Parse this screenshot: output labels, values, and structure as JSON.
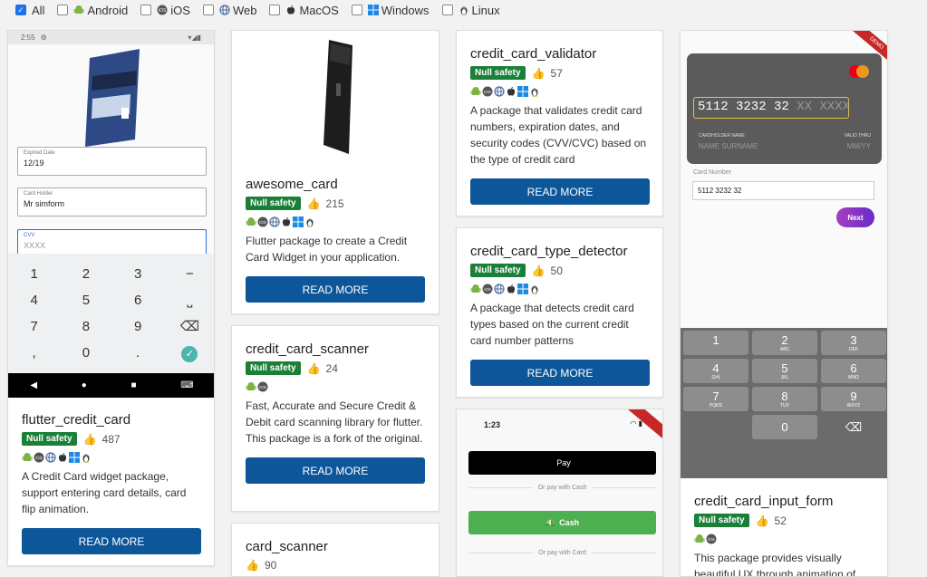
{
  "filters": [
    {
      "label": "All",
      "checked": true,
      "icon": "none"
    },
    {
      "label": "Android",
      "checked": false,
      "icon": "android-icon"
    },
    {
      "label": "iOS",
      "checked": false,
      "icon": "ios-icon"
    },
    {
      "label": "Web",
      "checked": false,
      "icon": "web-icon"
    },
    {
      "label": "MacOS",
      "checked": false,
      "icon": "apple-icon"
    },
    {
      "label": "Windows",
      "checked": false,
      "icon": "windows-icon"
    },
    {
      "label": "Linux",
      "checked": false,
      "icon": "linux-icon"
    }
  ],
  "common": {
    "null_safety": "Null safety",
    "read_more": "READ MORE",
    "thumb": "👍"
  },
  "colors": {
    "button": "#0d569a",
    "null_safety": "#1a7f37",
    "android": "#7cb342",
    "windows": "#1e88e5"
  },
  "cards": {
    "flutter_credit_card": {
      "title": "flutter_credit_card",
      "likes": "487",
      "desc": "A Credit Card widget package, support entering card details, card flip animation.",
      "shot": {
        "status_time": "2:55",
        "expired_label": "Expired Date",
        "expired_value": "12/19",
        "holder_label": "Card Holder",
        "holder_value": "Mr simform",
        "cvv_label": "CVV",
        "cvv_placeholder": "XXXX",
        "keys": [
          "1",
          "2",
          "3",
          "−",
          "4",
          "5",
          "6",
          "⎵",
          "7",
          "8",
          "9",
          "⌫",
          ",",
          "0",
          ".",
          "✓"
        ]
      }
    },
    "awesome_card": {
      "title": "awesome_card",
      "likes": "215",
      "desc": "Flutter package to create a Credit Card Widget in your application."
    },
    "credit_card_scanner": {
      "title": "credit_card_scanner",
      "likes": "24",
      "desc": "Fast, Accurate and Secure Credit & Debit card scanning library for flutter. This package is a fork of the original."
    },
    "card_scanner": {
      "title": "card_scanner",
      "likes": "90"
    },
    "credit_card_validator": {
      "title": "credit_card_validator",
      "likes": "57",
      "desc": "A package that validates credit card numbers, expiration dates, and security codes (CVV/CVC) based on the type of credit card"
    },
    "credit_card_type_detector": {
      "title": "credit_card_type_detector",
      "likes": "50",
      "desc": "A package that detects credit card types based on the current credit card number patterns"
    },
    "pay_shot": {
      "time": "1:23",
      "apple_pay": "Pay",
      "or_cash": "Or pay with Cash",
      "cash": "Cash",
      "or_card": "Or pay with Card"
    },
    "credit_card_input_form": {
      "title": "credit_card_input_form",
      "likes": "52",
      "desc": "This package provides visually beautiful UX through animation of",
      "shot": {
        "ribbon": "DEMO",
        "card_number": "5112 3232 32",
        "card_number_mask": "XX XXXX",
        "holder_label": "CARDHOLDER NAME",
        "holder_value": "NAME SURNAME",
        "valid_label": "VALID THRU",
        "valid_value": "MM/YY",
        "field_label": "Card Number",
        "field_value": "5112 3232 32",
        "next": "Next",
        "keys": [
          {
            "d": "1",
            "l": ""
          },
          {
            "d": "2",
            "l": "ABC"
          },
          {
            "d": "3",
            "l": "DEF"
          },
          {
            "d": "4",
            "l": "GHI"
          },
          {
            "d": "5",
            "l": "JKL"
          },
          {
            "d": "6",
            "l": "MNO"
          },
          {
            "d": "7",
            "l": "PQRS"
          },
          {
            "d": "8",
            "l": "TUV"
          },
          {
            "d": "9",
            "l": "WXYZ"
          }
        ],
        "zero": "0"
      }
    }
  }
}
